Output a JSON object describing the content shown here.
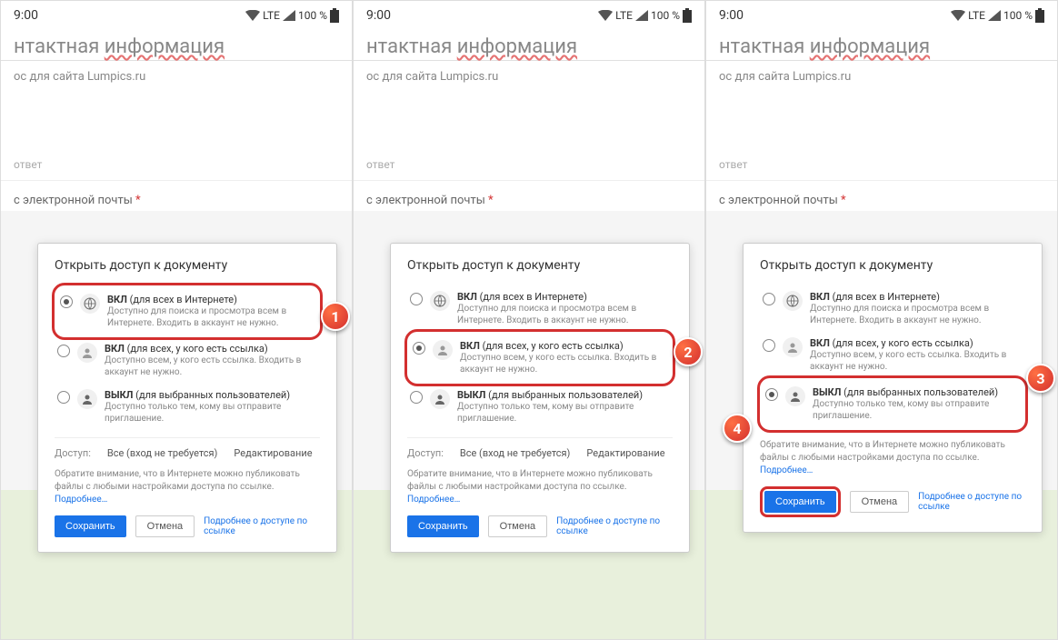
{
  "status": {
    "time": "9:00",
    "lte": "LTE",
    "battery": "100 %"
  },
  "page": {
    "title_a": "нтактная ",
    "title_b": "информация",
    "subtitle": "ос для сайта Lumpics.ru",
    "answer_hint": "ответ",
    "email_label": "с электронной почты",
    "req": "*"
  },
  "dialog": {
    "title": "Открыть доступ к документу",
    "opt1_title_a": "ВКЛ",
    "opt1_title_b": " (для всех в Интернете)",
    "opt1_desc": "Доступно для поиска и просмотра всем в Интернете. Входить в аккаунт не нужно.",
    "opt2_title_a": "ВКЛ",
    "opt2_title_b": " (для всех, у кого есть ссылка)",
    "opt2_desc": "Доступно всем, у кого есть ссылка. Входить в аккаунт не нужно.",
    "opt3_title_a": "ВЫКЛ",
    "opt3_title_b": " (для выбранных пользователей)",
    "opt3_desc": "Доступно только тем, кому вы отправите приглашение.",
    "access_label": "Доступ:",
    "access_val": "Все (вход не требуется)",
    "access_edit": "Редактирование",
    "note": "Обратите внимание, что в Интернете можно публиковать файлы с любыми настройками доступа по ссылке. ",
    "more": "Подробнее…",
    "save": "Сохранить",
    "cancel": "Отмена",
    "link_more": "Подробнее о доступе по ссылке"
  },
  "callouts": {
    "c1": "1",
    "c2": "2",
    "c3": "3",
    "c4": "4"
  }
}
